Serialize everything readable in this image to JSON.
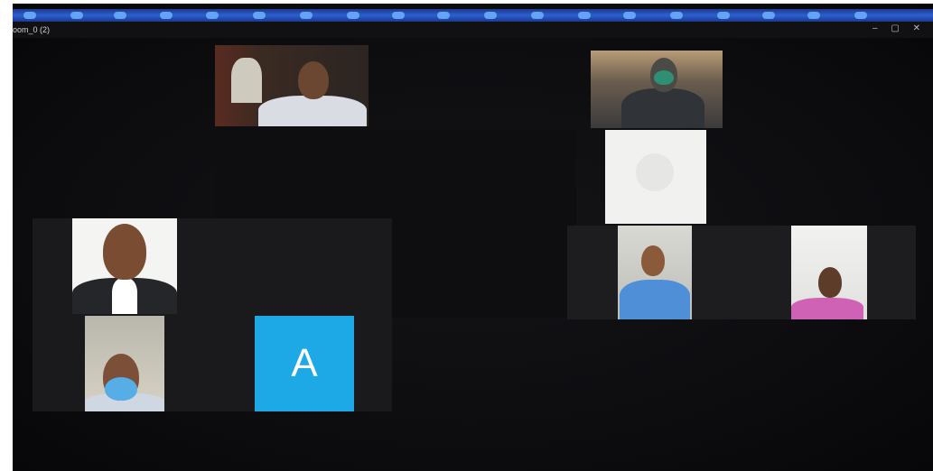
{
  "window": {
    "title": "oom_0 (2)",
    "controls": "– ▢ ✕"
  },
  "participants": [
    {
      "name_initial": "A"
    }
  ],
  "colors": {
    "screen_bg": "#0a0a0c",
    "avatar_blue": "#1ca9e6",
    "taskbar_blue": "#2e5fd0"
  }
}
